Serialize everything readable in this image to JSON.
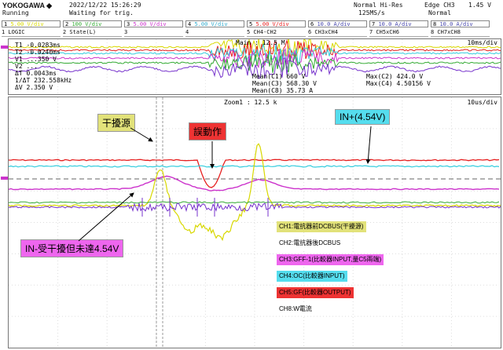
{
  "header": {
    "brand": "YOKOGAWA ◆",
    "datetime": "2022/12/22 15:26:29",
    "status_running": "Running",
    "status_trigger": "Waiting for trig.",
    "acq_mode": "Normal Hi-Res",
    "sample_rate": "125MS/s",
    "trigger_edge": "Edge CH3",
    "trigger_level": "1.45 V",
    "trigger_mode": "Normal"
  },
  "channels": [
    {
      "id": "1",
      "label": "5.00 V/div",
      "color": "#d8d800"
    },
    {
      "id": "2",
      "label": "100 V/div",
      "color": "#33aa33"
    },
    {
      "id": "3",
      "label": "5.00 V/div",
      "color": "#cc33cc"
    },
    {
      "id": "4",
      "label": "5.00 V/div",
      "color": "#33aacc"
    },
    {
      "id": "5",
      "label": "5.00 V/div",
      "color": "#e62020"
    },
    {
      "id": "6",
      "label": "10.0 A/div",
      "color": "#4444aa"
    },
    {
      "id": "7",
      "label": "10.0 A/div",
      "color": "#4444aa"
    },
    {
      "id": "8",
      "label": "10.0 A/div",
      "color": "#4444aa"
    }
  ],
  "math_row": [
    "LOGIC",
    "State(L)",
    "",
    "",
    "CH4-CH2",
    "CH3xCH4",
    "CH5xCH6",
    "CH7xCH8"
  ],
  "top_panel": {
    "timebase": "10ms/div",
    "main_label": "Main : 12.5 M",
    "cursor_lines": [
      "T1  -0.0283ms",
      "T2  -0.0240ms",
      "V1  ...350 V",
      "V2  ...",
      "ΔT  0.0043ms",
      "1/ΔT  232.558kHz",
      "ΔV  2.350 V"
    ],
    "measure_mid": [
      "Mean(C1)  660 V",
      "Mean(C3)  568.30 V",
      "Mean(C8)  35.73 A"
    ],
    "measure_right": [
      "Max(C2)  424.0 V",
      "Max(C4)  4.50156 V"
    ]
  },
  "zoom_panel": {
    "zoom_label": "Zoom1 : 12.5 k",
    "timebase": "10us/div"
  },
  "callouts": {
    "noise_source": "干擾源",
    "false_trip": "誤動作",
    "in_plus": "IN+(4.54V)",
    "in_minus": "IN-受干擾但未達4.54V"
  },
  "legend": [
    {
      "text": "CH1:電抗器前DCBUS(干擾源)",
      "bg": "#e2e27a",
      "color": "#000000"
    },
    {
      "text": "CH2:電抗器後DCBUS",
      "bg": "#ffffff",
      "color": "#000000"
    },
    {
      "text": "CH3:GFF-1(比較器INPUT,量C5兩端)",
      "bg": "#ee66ee",
      "color": "#000000"
    },
    {
      "text": "CH4:OC(比較器INPUT)",
      "bg": "#55ddee",
      "color": "#000000"
    },
    {
      "text": "CH5:GF(比較器OUTPUT)",
      "bg": "#ee3333",
      "color": "#000000"
    },
    {
      "text": "CH8:W電流",
      "bg": "#ffffff",
      "color": "#000000"
    }
  ]
}
